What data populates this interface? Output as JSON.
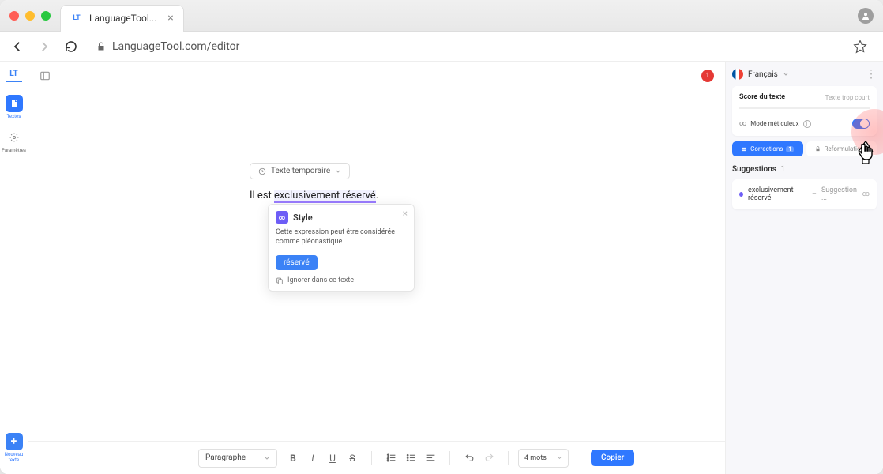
{
  "browser": {
    "tab_title": "LanguageTool...",
    "url": "LanguageTool.com/editor"
  },
  "left_rail": {
    "logo": "LT",
    "textes_label": "Textes",
    "parametres_label": "Paramètres",
    "nouveau_label": "Nouveau texte"
  },
  "editor": {
    "notifications_count": "1",
    "doc_title": "Texte temporaire",
    "text_prefix": "Il est ",
    "text_underlined": "exclusivement réservé",
    "text_suffix": "."
  },
  "popup": {
    "badge": "∞",
    "title": "Style",
    "description": "Cette expression peut être considérée comme pléonastique.",
    "suggestion": "réservé",
    "ignore": "Ignorer dans ce texte"
  },
  "bottombar": {
    "paragraph": "Paragraphe",
    "word_count": "4 mots",
    "copy": "Copier"
  },
  "right_panel": {
    "language": "Français",
    "score_title": "Score du texte",
    "score_status": "Texte trop court",
    "meticulous": "Mode méticuleux",
    "tab_corrections": "Corrections",
    "tab_corrections_badge": "1",
    "tab_reformulations": "Reformulations",
    "suggestions_heading": "Suggestions",
    "suggestions_count": "1",
    "suggestion_item_text": "exclusivement réservé",
    "suggestion_item_label": "Suggestion ..."
  }
}
